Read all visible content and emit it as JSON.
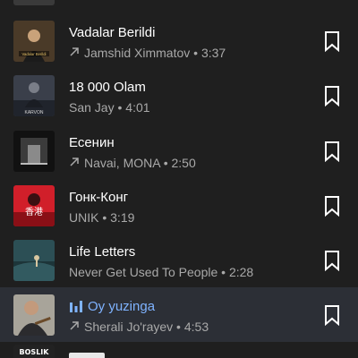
{
  "tracks": [
    {
      "title": "Vadalar Berildi",
      "trending": true,
      "artist": "Jamshid Ximmatov",
      "duration": "3:37",
      "cover_text": "Vadalar Berildi"
    },
    {
      "title": "18 000 Olam",
      "trending": false,
      "artist": "San Jay",
      "duration": "4:01",
      "cover_text": "KARVON"
    },
    {
      "title": "Есенин",
      "trending": true,
      "artist": "Navai, MONA",
      "duration": "2:50",
      "cover_text": ""
    },
    {
      "title": "Гонк-Конг",
      "trending": false,
      "artist": "UNIK",
      "duration": "3:19",
      "cover_text": "香港"
    },
    {
      "title": "Life Letters",
      "trending": false,
      "artist": "Never Get Used To People",
      "duration": "2:28",
      "cover_text": ""
    },
    {
      "title": "Oy yuzinga",
      "trending": true,
      "artist": "Sherali Jo'rayev",
      "duration": "4:53",
      "playing": true,
      "cover_text": ""
    }
  ],
  "separator": " • ",
  "colors": {
    "background": "#1f1f1f",
    "playing_row": "#2c2f36",
    "playing_title": "#7fb3ff",
    "subtitle": "#a9a9a9"
  },
  "icons": {
    "trend": "arrow-up-right-icon",
    "save": "bookmark-icon",
    "playing": "equalizer-icon"
  },
  "partial_bottom_cover_text": "BOSLIK"
}
